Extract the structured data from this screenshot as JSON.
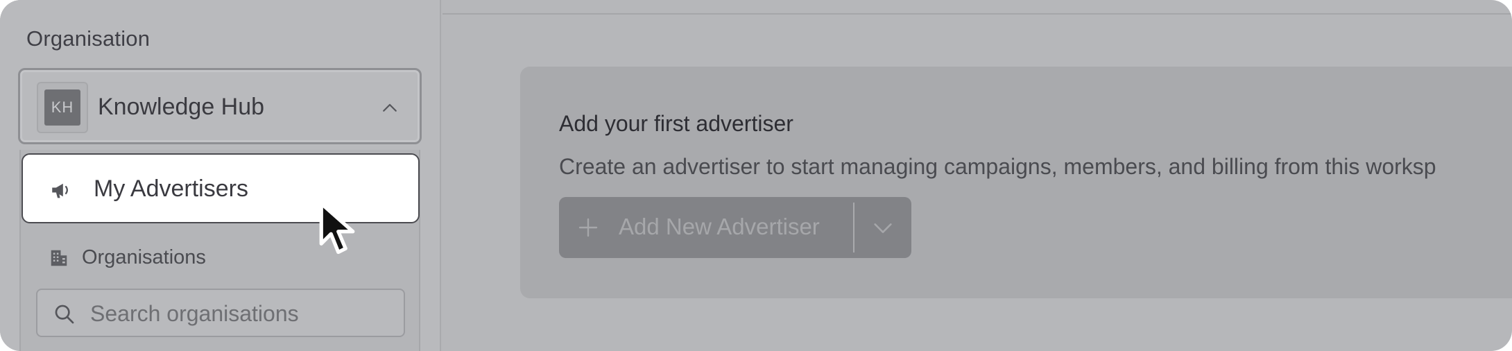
{
  "sidebar": {
    "org_label": "Organisation",
    "selected_org": {
      "initials": "KH",
      "name": "Knowledge Hub"
    },
    "menu": {
      "active_item": "My Advertisers",
      "section_title": "Organisations",
      "search_placeholder": "Search organisations"
    }
  },
  "main": {
    "empty_state": {
      "title": "Add your first advertiser",
      "description": "Create an advertiser to start managing campaigns, members, and billing from this worksp",
      "add_button_label": "Add New Advertiser"
    }
  },
  "icons": {
    "select_chevron": "chevron-up-icon",
    "active_item": "megaphone-icon",
    "section": "building-icon",
    "search": "search-icon",
    "add": "plus-icon",
    "split": "chevron-down-icon",
    "pointer": "cursor-arrow-icon"
  }
}
